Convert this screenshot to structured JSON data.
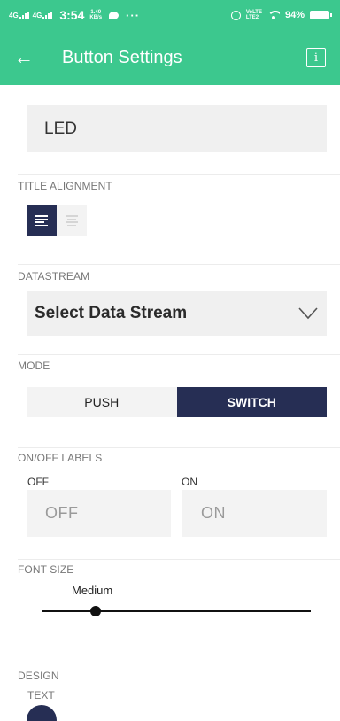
{
  "status_bar": {
    "signal_1": "4G",
    "signal_2": "4G",
    "time": "3:54",
    "net_speed_value": "1.40",
    "net_speed_unit": "KB/s",
    "more": "···",
    "volte_top": "VoLTE",
    "volte_bottom": "LTE2",
    "battery": "94%"
  },
  "app_bar": {
    "back_icon": "arrow-left-icon",
    "title": "Button Settings",
    "info_icon": "info-icon",
    "info_glyph": "i"
  },
  "name_field": {
    "value": "LED"
  },
  "title_alignment": {
    "label": "TITLE ALIGNMENT",
    "selected": "left"
  },
  "datastream": {
    "label": "DATASTREAM",
    "placeholder": "Select Data Stream"
  },
  "mode": {
    "label": "MODE",
    "options": [
      "PUSH",
      "SWITCH"
    ],
    "selected": "SWITCH"
  },
  "on_off_labels": {
    "label": "ON/OFF LABELS",
    "off_caption": "OFF",
    "on_caption": "ON",
    "off_placeholder": "OFF",
    "on_placeholder": "ON"
  },
  "font_size": {
    "label": "FONT SIZE",
    "value": "Medium",
    "slider_fraction": 0.2
  },
  "design": {
    "label": "DESIGN",
    "text_label": "TEXT",
    "text_color": "#262e54"
  },
  "colors": {
    "accent": "#3cc88e",
    "dark": "#262e54"
  }
}
